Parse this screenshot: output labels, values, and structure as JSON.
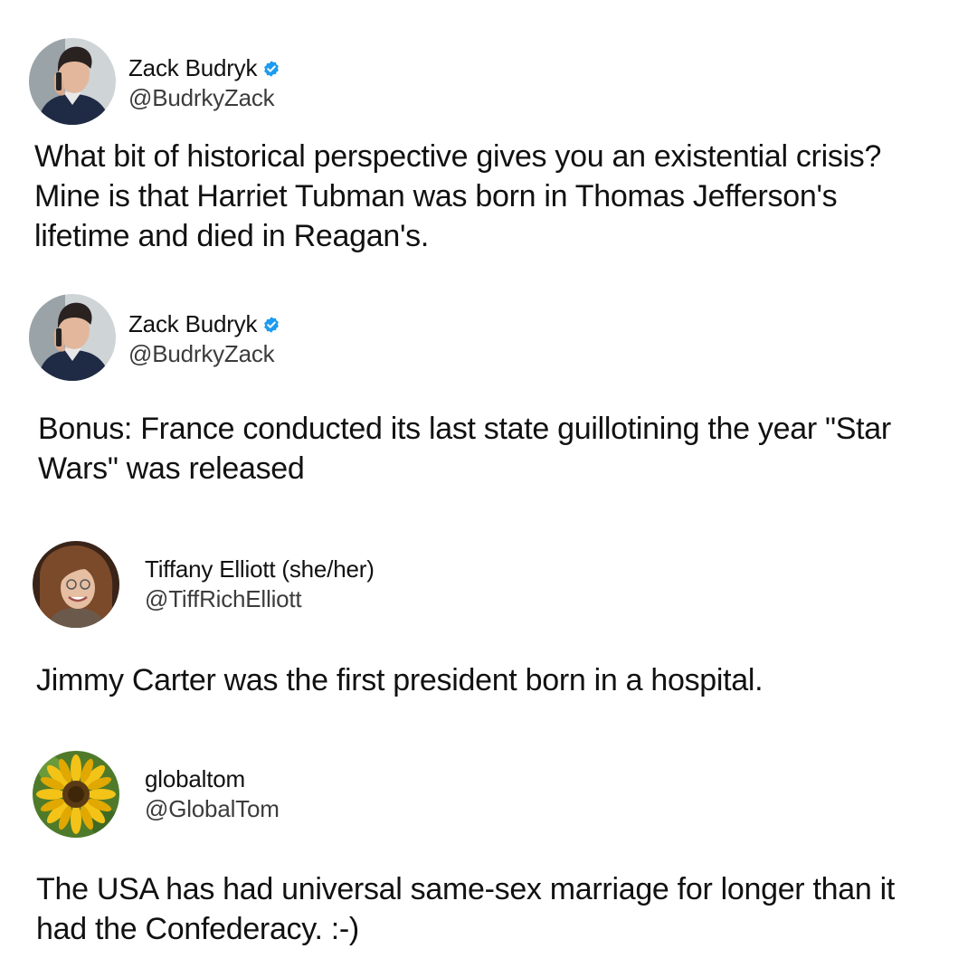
{
  "tweets": [
    {
      "display_name": "Zack Budryk",
      "handle": "@BudrkyZack",
      "verified": true,
      "avatar": "profile-photo-man-on-phone",
      "text": "What bit of historical perspective gives you an existential crisis? Mine is that Harriet Tubman was born in Thomas Jefferson's lifetime and died in Reagan's."
    },
    {
      "display_name": "Zack Budryk",
      "handle": "@BudrkyZack",
      "verified": true,
      "avatar": "profile-photo-man-on-phone",
      "text": "Bonus: France conducted its last state guillotining the year \"Star Wars\" was released"
    },
    {
      "display_name": "Tiffany Elliott (she/her)",
      "handle": "@TiffRichElliott",
      "verified": false,
      "avatar": "profile-photo-woman-glasses",
      "text": "Jimmy Carter was the first president born in a hospital."
    },
    {
      "display_name": "globaltom",
      "handle": "@GlobalTom",
      "verified": false,
      "avatar": "profile-photo-sunflower",
      "text": "The USA has had universal same-sex marriage for longer than it had the Confederacy. :-)"
    }
  ],
  "colors": {
    "verified_badge": "#1d9bf0",
    "text": "#111111",
    "handle": "#3c3c3c",
    "background": "#ffffff"
  }
}
